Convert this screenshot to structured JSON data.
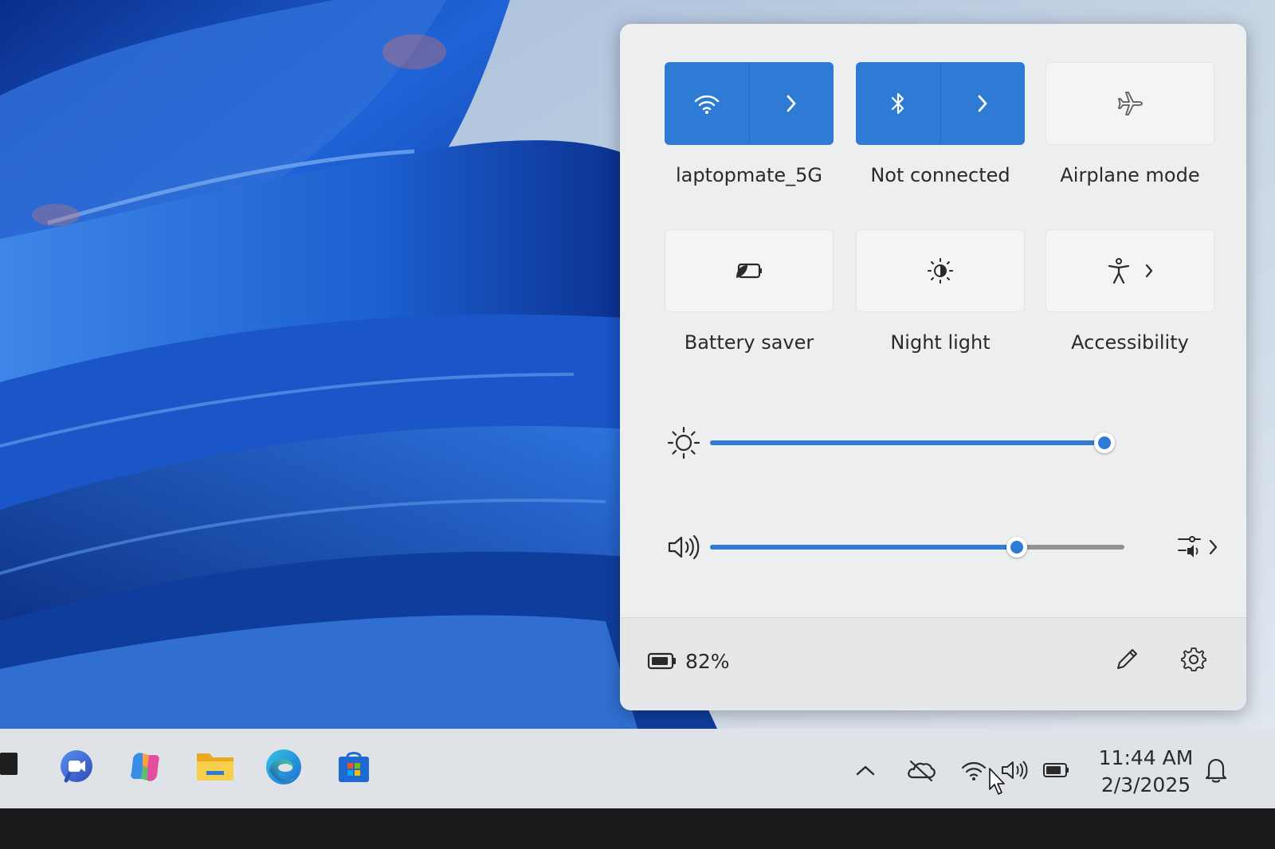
{
  "quick_settings": {
    "tiles": [
      {
        "id": "wifi",
        "label": "laptopmate_5G",
        "state": "on",
        "icon": "wifi-icon",
        "has_arrow": true
      },
      {
        "id": "bluetooth",
        "label": "Not connected",
        "state": "on",
        "icon": "bluetooth-icon",
        "has_arrow": true
      },
      {
        "id": "airplane",
        "label": "Airplane mode",
        "state": "off",
        "icon": "airplane-icon",
        "has_arrow": false
      },
      {
        "id": "battery-saver",
        "label": "Battery saver",
        "state": "off",
        "icon": "battery-saver-icon",
        "has_arrow": false
      },
      {
        "id": "night-light",
        "label": "Night light",
        "state": "off",
        "icon": "night-light-icon",
        "has_arrow": false
      },
      {
        "id": "accessibility",
        "label": "Accessibility",
        "state": "off",
        "icon": "accessibility-icon",
        "has_arrow": true
      }
    ],
    "brightness": {
      "icon": "brightness-icon",
      "level_percent": 100
    },
    "volume": {
      "icon": "speaker-icon",
      "level_percent": 74,
      "extra_icon": "audio-output-icon"
    },
    "footer": {
      "battery_percent": "82%",
      "battery_icon": "battery-icon",
      "edit_icon": "pencil-icon",
      "settings_icon": "gear-icon"
    }
  },
  "taskbar": {
    "apps": [
      "meet-icon",
      "copilot-icon",
      "file-explorer-icon",
      "edge-icon",
      "store-icon"
    ],
    "tray_icons": [
      "chevron-up-icon",
      "onedrive-icon",
      "wifi-icon",
      "speaker-icon",
      "battery-icon",
      "bell-icon"
    ],
    "time": "11:44 AM",
    "date": "2/3/2025"
  },
  "colors": {
    "accent": "#2e7bd6",
    "panel_bg": "#eceeef",
    "taskbar_bg": "#dfe3e8"
  }
}
